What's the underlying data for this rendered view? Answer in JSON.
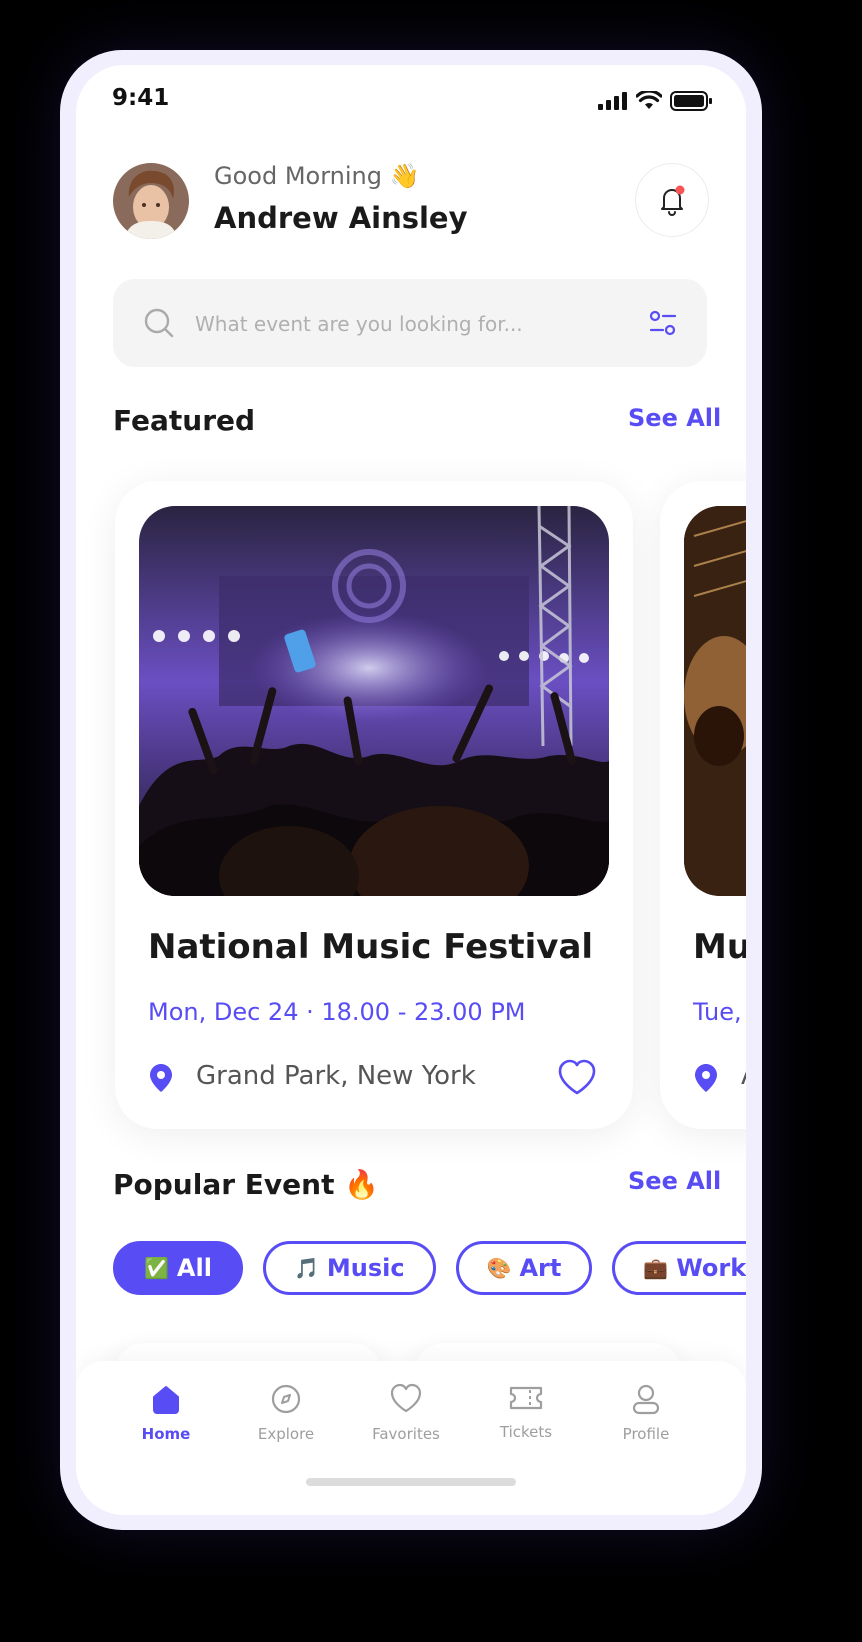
{
  "status_bar": {
    "time": "9:41"
  },
  "header": {
    "greeting": "Good Morning 👋",
    "user_name": "Andrew Ainsley"
  },
  "search": {
    "placeholder": "What event are you looking for..."
  },
  "featured": {
    "title": "Featured",
    "see_all": "See All",
    "cards": [
      {
        "title": "National Music Festival",
        "date": "Mon, Dec 24 · 18.00 - 23.00 PM",
        "location": "Grand Park, New York"
      },
      {
        "title": "Mu",
        "date": "Tue,",
        "location": "A"
      }
    ]
  },
  "popular": {
    "title": "Popular Event 🔥",
    "see_all": "See All",
    "chips": [
      {
        "emoji": "✅",
        "label": "All",
        "active": true
      },
      {
        "emoji": "🎵",
        "label": "Music",
        "active": false
      },
      {
        "emoji": "🎨",
        "label": "Art",
        "active": false
      },
      {
        "emoji": "💼",
        "label": "Workshops",
        "active": false
      }
    ]
  },
  "tabbar": {
    "tabs": [
      {
        "label": "Home",
        "icon": "home-icon",
        "active": true
      },
      {
        "label": "Explore",
        "icon": "compass-icon",
        "active": false
      },
      {
        "label": "Favorites",
        "icon": "heart-icon",
        "active": false
      },
      {
        "label": "Tickets",
        "icon": "ticket-icon",
        "active": false
      },
      {
        "label": "Profile",
        "icon": "user-icon",
        "active": false
      }
    ]
  },
  "colors": {
    "accent": "#584cf4",
    "notification_dot": "#f75555"
  }
}
